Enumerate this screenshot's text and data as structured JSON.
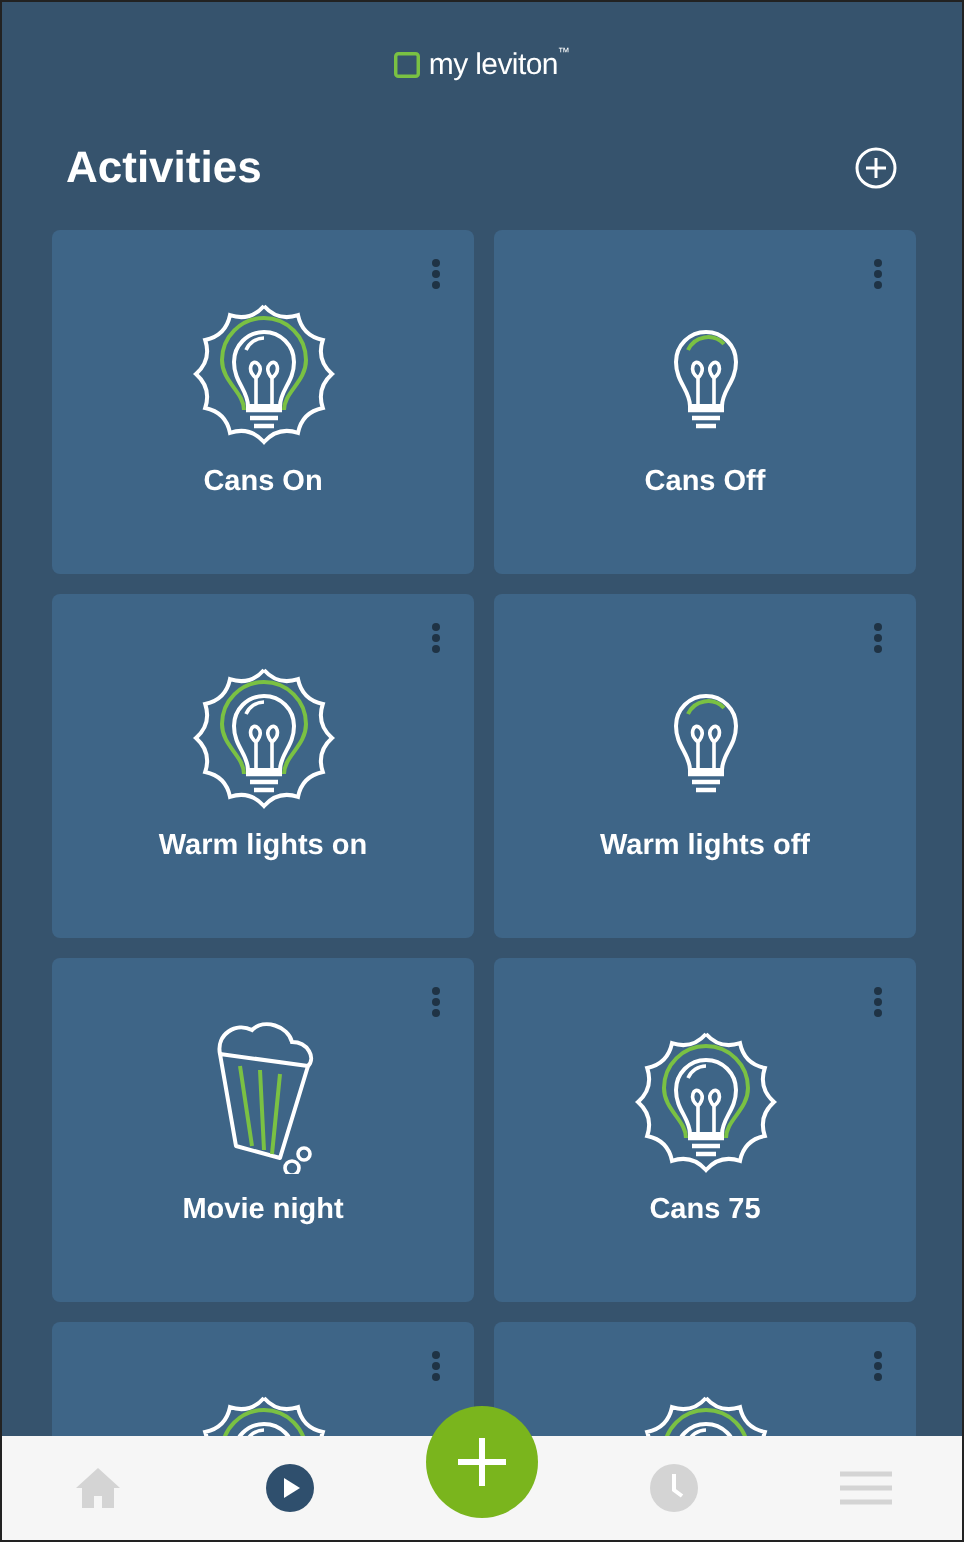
{
  "header": {
    "logo": "my leviton",
    "trademark": "™"
  },
  "title": "Activities",
  "activities": [
    {
      "label": "Cans On",
      "kind": "bulb-on"
    },
    {
      "label": "Cans Off",
      "kind": "bulb-off"
    },
    {
      "label": "Warm lights on",
      "kind": "bulb-on"
    },
    {
      "label": "Warm lights off",
      "kind": "bulb-off"
    },
    {
      "label": "Movie night",
      "kind": "popcorn"
    },
    {
      "label": "Cans 75",
      "kind": "bulb-on"
    },
    {
      "kind": "bulb-on"
    },
    {
      "kind": "bulb-on"
    }
  ],
  "nav": [
    {
      "kind": "home",
      "selected": false
    },
    {
      "kind": "activities",
      "selected": true
    },
    {
      "kind": "fab"
    },
    {
      "kind": "schedule",
      "selected": false
    },
    {
      "kind": "menu",
      "selected": false
    }
  ]
}
